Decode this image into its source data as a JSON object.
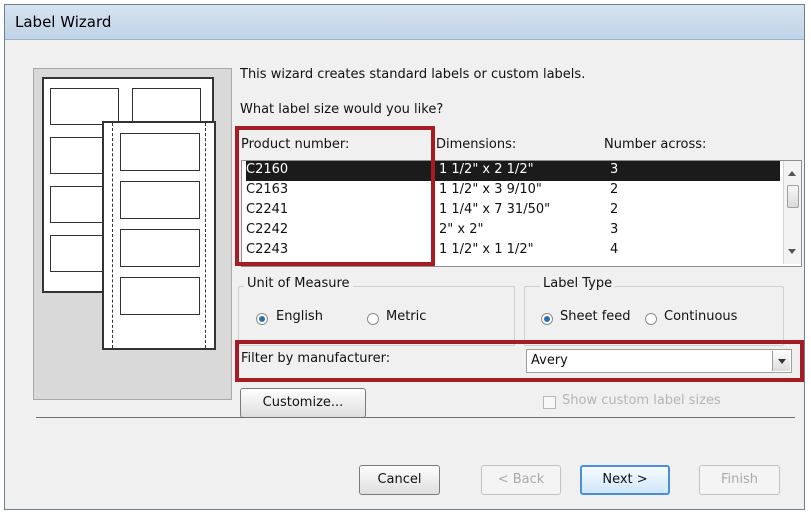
{
  "window": {
    "title": "Label Wizard"
  },
  "intro": {
    "description": "This wizard creates standard labels or custom labels.",
    "question": "What label size would you like?"
  },
  "table": {
    "headers": [
      "Product number:",
      "Dimensions:",
      "Number across:"
    ],
    "rows": [
      {
        "product": "C2160",
        "dimensions": "1 1/2\" x 2 1/2\"",
        "across": "3"
      },
      {
        "product": "C2163",
        "dimensions": "1 1/2\" x 3 9/10\"",
        "across": "2"
      },
      {
        "product": "C2241",
        "dimensions": "1 1/4\" x 7 31/50\"",
        "across": "2"
      },
      {
        "product": "C2242",
        "dimensions": "2\" x 2\"",
        "across": "3"
      },
      {
        "product": "C2243",
        "dimensions": "1 1/2\" x 1 1/2\"",
        "across": "4"
      }
    ]
  },
  "unit_of_measure": {
    "label": "Unit of Measure",
    "options": [
      "English",
      "Metric"
    ],
    "selected": "English"
  },
  "label_type": {
    "label": "Label Type",
    "options": [
      "Sheet feed",
      "Continuous"
    ],
    "selected": "Sheet feed"
  },
  "filter": {
    "label": "Filter by  manufacturer:",
    "value": "Avery"
  },
  "buttons": {
    "customize": "Customize...",
    "show_custom": "Show custom label sizes",
    "cancel": "Cancel",
    "back": "< Back",
    "next": "Next >",
    "finish": "Finish"
  },
  "colors": {
    "highlight_border": "#a51d24",
    "selected_row": "#1b1b1b",
    "window_bg": "#f0f0f0"
  }
}
